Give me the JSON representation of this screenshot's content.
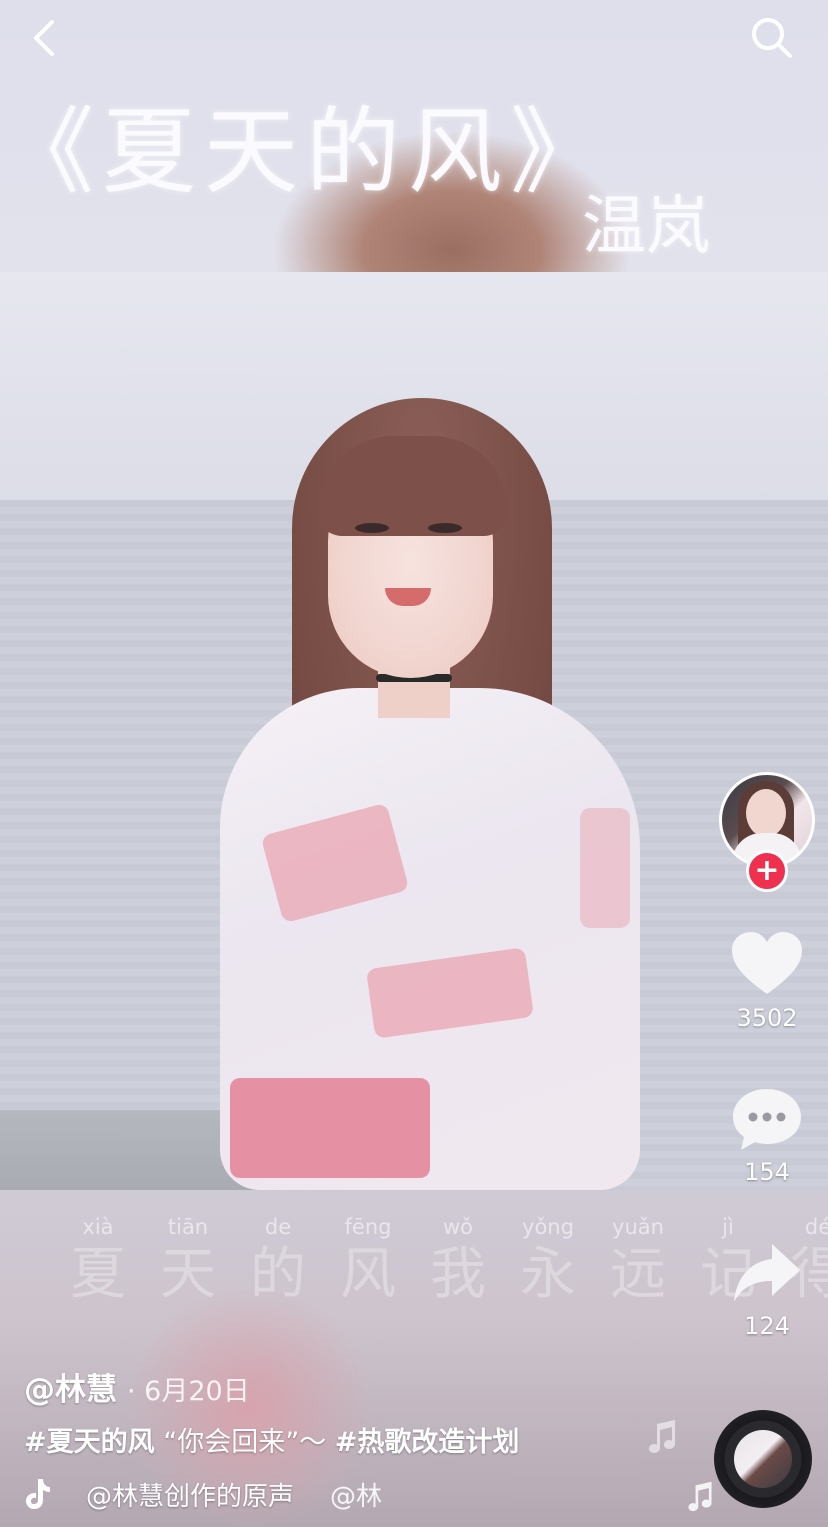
{
  "overlay": {
    "title": "《夏天的风》",
    "singer": "温岚"
  },
  "lyric": [
    {
      "py": "xià",
      "hz": "夏"
    },
    {
      "py": "tiān",
      "hz": "天"
    },
    {
      "py": "de",
      "hz": "的"
    },
    {
      "py": "fēng",
      "hz": "风"
    },
    {
      "py": "wǒ",
      "hz": "我"
    },
    {
      "py": "yǒng",
      "hz": "永"
    },
    {
      "py": "yuǎn",
      "hz": "远"
    },
    {
      "py": "jì",
      "hz": "记"
    },
    {
      "py": "dé",
      "hz": "得"
    }
  ],
  "rail": {
    "like_count": "3502",
    "comment_count": "154",
    "share_count": "124",
    "follow_symbol": "+"
  },
  "info": {
    "author": "@林慧",
    "date": "· 6月20日",
    "caption_tag1": "#夏天的风",
    "caption_text": " “你会回来”～ ",
    "caption_tag2": "#热歌改造计划",
    "music": "@林慧创作的原声",
    "music_marquee": "@林"
  },
  "icons": {
    "back": "chevron-left-icon",
    "search": "search-icon",
    "like": "heart-icon",
    "comment": "comment-bubble-icon",
    "share": "share-arrow-icon",
    "music": "tiktok-note-icon"
  },
  "colors": {
    "follow": "#f0304f",
    "text": "#ffffff"
  }
}
